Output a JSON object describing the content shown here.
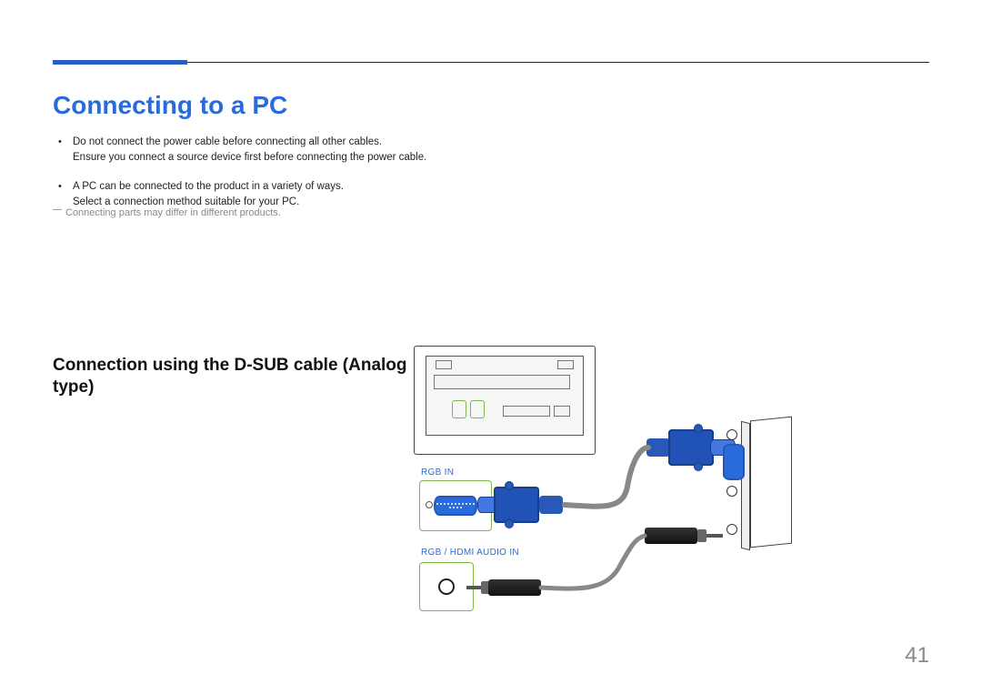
{
  "page": {
    "title": "Connecting to a PC",
    "number": "41"
  },
  "bullets": [
    {
      "line1": "Do not connect the power cable before connecting all other cables.",
      "line2": "Ensure you connect a source device first before connecting the power cable."
    },
    {
      "line1": "A PC can be connected to the product in a variety of ways.",
      "line2": "Select a connection method suitable for your PC."
    }
  ],
  "note": "Connecting parts may differ in different products.",
  "subsection": {
    "title": "Connection using the D-SUB cable (Analog type)"
  },
  "diagram": {
    "labels": {
      "rgb_in": "RGB IN",
      "audio_in": "RGB / HDMI AUDIO IN"
    }
  }
}
